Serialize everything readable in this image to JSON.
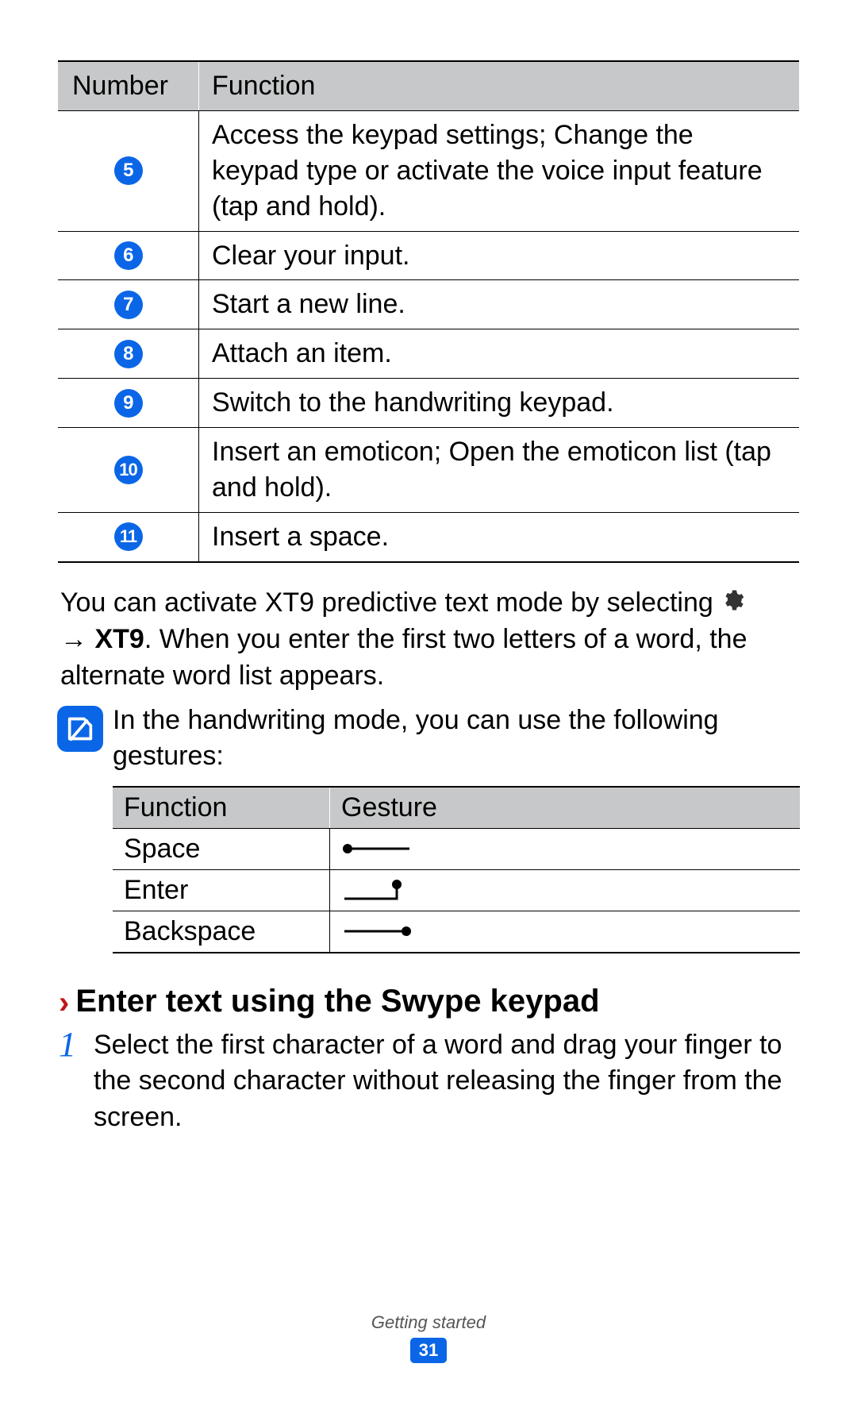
{
  "table1": {
    "header": {
      "number": "Number",
      "function": "Function"
    },
    "rows": [
      {
        "num": "5",
        "func": "Access the keypad settings; Change the keypad type or activate the voice input feature (tap and hold)."
      },
      {
        "num": "6",
        "func": "Clear your input."
      },
      {
        "num": "7",
        "func": "Start a new line."
      },
      {
        "num": "8",
        "func": "Attach an item."
      },
      {
        "num": "9",
        "func": "Switch to the handwriting keypad."
      },
      {
        "num": "10",
        "func": "Insert an emoticon; Open the emoticon list (tap and hold)."
      },
      {
        "num": "11",
        "func": "Insert a space."
      }
    ]
  },
  "paragraph": {
    "part1": "You can activate XT9 predictive text mode by selecting ",
    "arrow": "→ ",
    "xt9": "XT9",
    "part2": ". When you enter the first two letters of a word, the alternate word list appears."
  },
  "note": {
    "text": "In the handwriting mode, you can use the following gestures:"
  },
  "table2": {
    "header": {
      "function": "Function",
      "gesture": "Gesture"
    },
    "rows": [
      {
        "func": "Space",
        "gesture": "space"
      },
      {
        "func": "Enter",
        "gesture": "enter"
      },
      {
        "func": "Backspace",
        "gesture": "backspace"
      }
    ]
  },
  "section": {
    "title": "Enter text using the Swype keypad",
    "step_num": "1",
    "step_text": "Select the first character of a word and drag your finger to the second character without releasing the finger from the screen."
  },
  "footer": {
    "label": "Getting started",
    "page": "31"
  }
}
